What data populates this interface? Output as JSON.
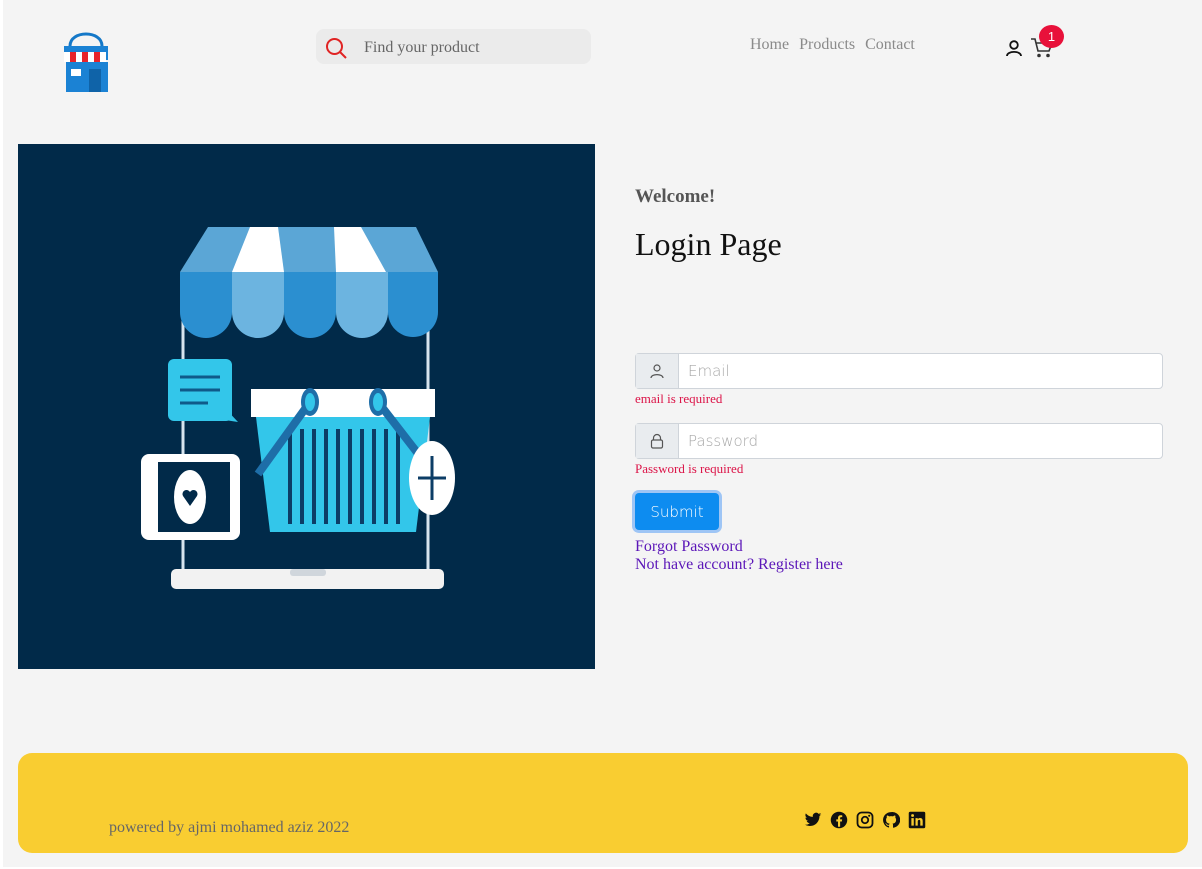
{
  "header": {
    "search": {
      "placeholder": "Find your product"
    },
    "nav": [
      "Home",
      "Products",
      "Contact"
    ],
    "cart_count": "1"
  },
  "login": {
    "welcome": "Welcome!",
    "title": "Login Page",
    "email": {
      "placeholder": "Email",
      "error": "email is required"
    },
    "password": {
      "placeholder": "Password",
      "error": "Password is required"
    },
    "submit_label": "Submit",
    "forgot_label": "Forgot Password",
    "register_label": "Not have account? Register here"
  },
  "footer": {
    "powered": "powered by ajmi mohamed aziz 2022",
    "socials": [
      "twitter-icon",
      "facebook-icon",
      "instagram-icon",
      "github-icon",
      "linkedin-icon"
    ]
  },
  "colors": {
    "accent": "#0d8cf0",
    "error": "#dc1448",
    "link": "#5b16b8",
    "footer": "#f9cd31",
    "hero_bg": "#012a49",
    "badge": "#e8113a"
  }
}
